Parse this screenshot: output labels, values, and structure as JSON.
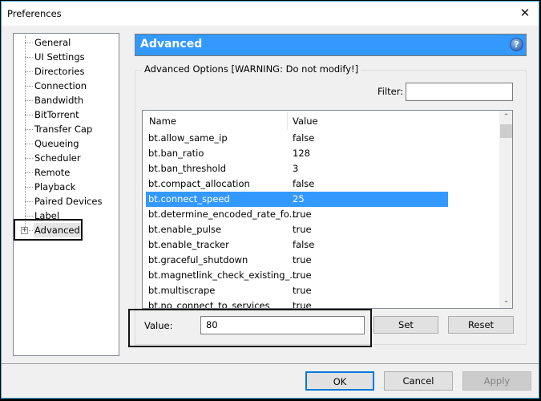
{
  "window": {
    "title": "Preferences",
    "close_icon": "close-icon"
  },
  "sidebar": {
    "items": [
      {
        "label": "General"
      },
      {
        "label": "UI Settings"
      },
      {
        "label": "Directories"
      },
      {
        "label": "Connection"
      },
      {
        "label": "Bandwidth"
      },
      {
        "label": "BitTorrent"
      },
      {
        "label": "Transfer Cap"
      },
      {
        "label": "Queueing"
      },
      {
        "label": "Scheduler"
      },
      {
        "label": "Remote"
      },
      {
        "label": "Playback"
      },
      {
        "label": "Paired Devices"
      },
      {
        "label": "Label"
      },
      {
        "label": "Advanced",
        "selected": true,
        "expand_icon": "plus-icon",
        "expand_glyph": "+"
      }
    ]
  },
  "header": {
    "title": "Advanced",
    "help_glyph": "?",
    "accent": "#3399ff"
  },
  "options": {
    "group_label": "Advanced Options [WARNING: Do not modify!]",
    "filter_label": "Filter:",
    "filter_value": "",
    "columns": {
      "name": "Name",
      "value": "Value"
    },
    "rows": [
      {
        "name": "bt.allow_same_ip",
        "value": "false"
      },
      {
        "name": "bt.ban_ratio",
        "value": "128"
      },
      {
        "name": "bt.ban_threshold",
        "value": "3"
      },
      {
        "name": "bt.compact_allocation",
        "value": "false"
      },
      {
        "name": "bt.connect_speed",
        "value": "25",
        "selected": true
      },
      {
        "name": "bt.determine_encoded_rate_fo...",
        "value": "true"
      },
      {
        "name": "bt.enable_pulse",
        "value": "true"
      },
      {
        "name": "bt.enable_tracker",
        "value": "false"
      },
      {
        "name": "bt.graceful_shutdown",
        "value": "true"
      },
      {
        "name": "bt.magnetlink_check_existing_...",
        "value": "true"
      },
      {
        "name": "bt.multiscrape",
        "value": "true"
      },
      {
        "name": "bt.no_connect_to_services",
        "value": "true"
      }
    ],
    "scroll_up_glyph": "⌃",
    "scroll_down_glyph": "⌄"
  },
  "editor": {
    "value_label": "Value:",
    "value": "80",
    "set_label": "Set",
    "reset_label": "Reset"
  },
  "footer": {
    "ok_label": "OK",
    "cancel_label": "Cancel",
    "apply_label": "Apply"
  }
}
